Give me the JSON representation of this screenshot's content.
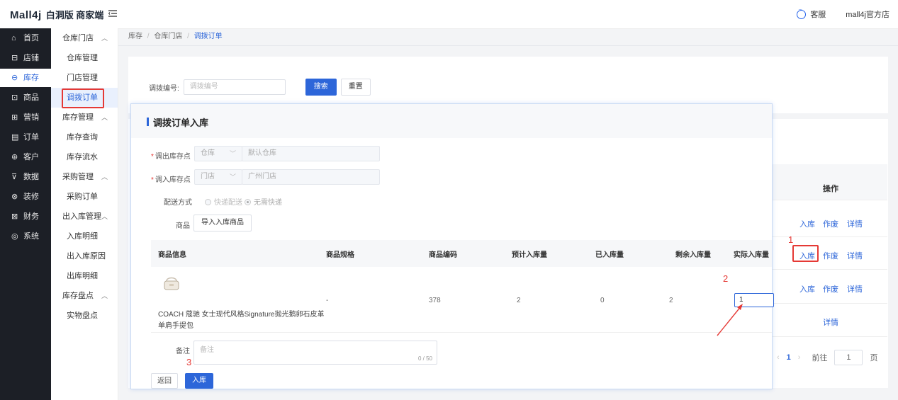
{
  "header": {
    "brand": "Mall4j",
    "subtitle": "白洞版 商家端",
    "customer_service": "客服",
    "shop_name": "mall4j官方店"
  },
  "main_nav": [
    {
      "icon": "home-icon",
      "glyph": "⌂",
      "label": "首页"
    },
    {
      "icon": "shop-icon",
      "glyph": "⊟",
      "label": "店铺"
    },
    {
      "icon": "inventory-icon",
      "glyph": "⊖",
      "label": "库存",
      "active": true
    },
    {
      "icon": "goods-icon",
      "glyph": "⊡",
      "label": "商品"
    },
    {
      "icon": "marketing-icon",
      "glyph": "⊞",
      "label": "营销"
    },
    {
      "icon": "order-icon",
      "glyph": "▤",
      "label": "订单"
    },
    {
      "icon": "customer-icon",
      "glyph": "⊛",
      "label": "客户"
    },
    {
      "icon": "data-icon",
      "glyph": "⊽",
      "label": "数据"
    },
    {
      "icon": "decorate-icon",
      "glyph": "⊗",
      "label": "装修"
    },
    {
      "icon": "finance-icon",
      "glyph": "⊠",
      "label": "财务"
    },
    {
      "icon": "system-icon",
      "glyph": "◎",
      "label": "系统"
    }
  ],
  "sub_nav": {
    "warehouse_group": "仓库门店",
    "warehouse_manage": "仓库管理",
    "store_manage": "门店管理",
    "transfer_order": "调拨订单",
    "stock_group": "库存管理",
    "stock_query": "库存查询",
    "stock_flow": "库存流水",
    "purchase_group": "采购管理",
    "purchase_order": "采购订单",
    "inout_group": "出入库管理",
    "in_detail": "入库明细",
    "out_reason": "出入库原因",
    "out_detail": "出库明细",
    "check_group": "库存盘点",
    "physical_check": "实物盘点"
  },
  "breadcrumb": {
    "l1": "库存",
    "sep": "/",
    "l2": "仓库门店",
    "l3": "调拨订单"
  },
  "search": {
    "label": "调拨编号:",
    "placeholder": "调拨编号",
    "search_btn": "搜索",
    "reset_btn": "重置"
  },
  "list": {
    "op_header": "操作",
    "rows": [
      {
        "a": "入库",
        "b": "作废",
        "c": "详情"
      },
      {
        "a": "入库",
        "b": "作废",
        "c": "详情"
      },
      {
        "a": "入库",
        "b": "作废",
        "c": "详情"
      },
      {
        "c": "详情"
      }
    ]
  },
  "pager": {
    "prev": "‹",
    "page": "1",
    "next": "›",
    "goto": "前往",
    "value": "1",
    "suffix": "页"
  },
  "modal": {
    "title": "调拨订单入库",
    "out_label": "调出库存点",
    "out_type": "仓库",
    "out_value": "默认仓库",
    "in_label": "调入库存点",
    "in_type": "门店",
    "in_value": "广州门店",
    "ship_label": "配送方式",
    "ship_opt1": "快递配送",
    "ship_opt2": "无需快递",
    "goods_label": "商品",
    "import_btn": "导入入库商品",
    "table_headers": {
      "info": "商品信息",
      "spec": "商品规格",
      "code": "商品编码",
      "expected": "预计入库量",
      "received": "已入库量",
      "remaining": "剩余入库量",
      "actual": "实际入库量"
    },
    "row": {
      "name_line1": "COACH 蔻驰 女士现代风格Signature抛光鹅卵石皮革",
      "name_line2": "单肩手提包",
      "spec": "-",
      "code": "378",
      "expected": "2",
      "received": "0",
      "remaining": "2",
      "actual": "1"
    },
    "remark_label": "备注",
    "remark_placeholder": "备注",
    "remark_count": "0 / 50",
    "back_btn": "返回",
    "submit_btn": "入库"
  },
  "annotations": {
    "n1": "1",
    "n2": "2",
    "n3": "3"
  },
  "colors": {
    "accent": "#2d66d9",
    "sidebar_bg": "#1c1f26",
    "annotation_red": "#e53935"
  }
}
